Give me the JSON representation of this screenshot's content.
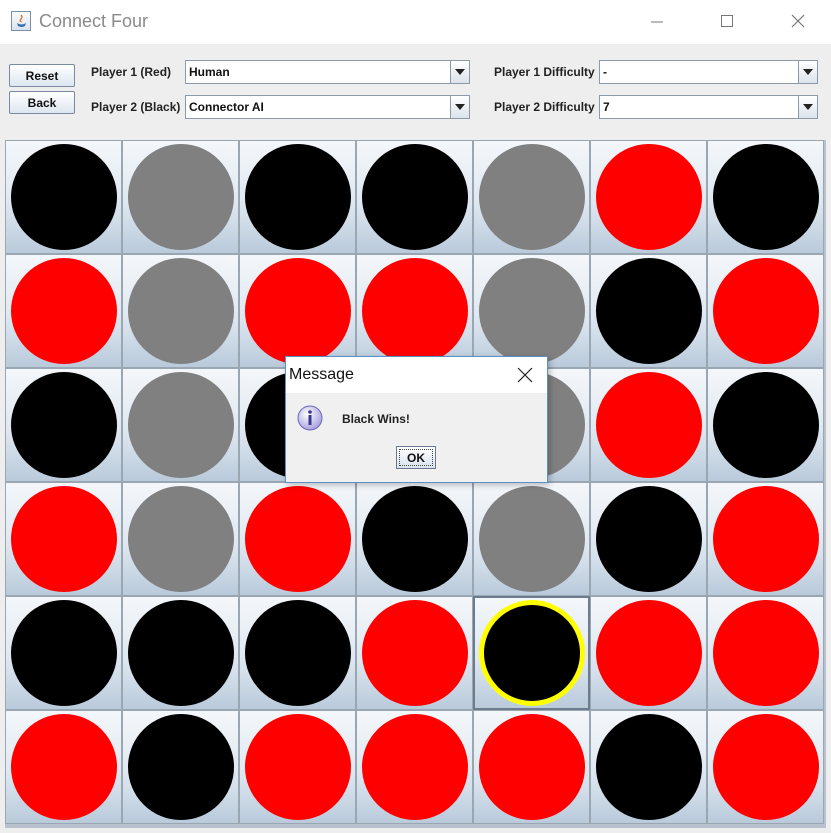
{
  "window": {
    "title": "Connect Four"
  },
  "controls": {
    "reset_label": "Reset",
    "back_label": "Back",
    "player1_label": "Player 1 (Red)",
    "player1_value": "Human",
    "player2_label": "Player 2 (Black)",
    "player2_value": "Connector AI",
    "p1_difficulty_label": "Player 1 Difficulty",
    "p1_difficulty_value": "-",
    "p2_difficulty_label": "Player 2 Difficulty",
    "p2_difficulty_value": "7"
  },
  "colors": {
    "red": "#ff0000",
    "black": "#000000",
    "gray": "#808080",
    "highlight": "#ffff00"
  },
  "board": {
    "rows": 6,
    "cols": 7,
    "cells": [
      [
        "black",
        "gray",
        "black",
        "black",
        "gray",
        "red",
        "black"
      ],
      [
        "red",
        "gray",
        "red",
        "red",
        "gray",
        "black",
        "red"
      ],
      [
        "black",
        "gray",
        "black",
        "black",
        "gray",
        "red",
        "black"
      ],
      [
        "red",
        "gray",
        "red",
        "black",
        "gray",
        "black",
        "red"
      ],
      [
        "black",
        "black",
        "black",
        "red",
        "black",
        "red",
        "red"
      ],
      [
        "red",
        "black",
        "red",
        "red",
        "red",
        "black",
        "red"
      ]
    ],
    "highlighted_cell": {
      "row": 4,
      "col": 4
    }
  },
  "dialog": {
    "title": "Message",
    "message": "Black Wins!",
    "ok_label": "OK",
    "icon": "info-icon"
  }
}
